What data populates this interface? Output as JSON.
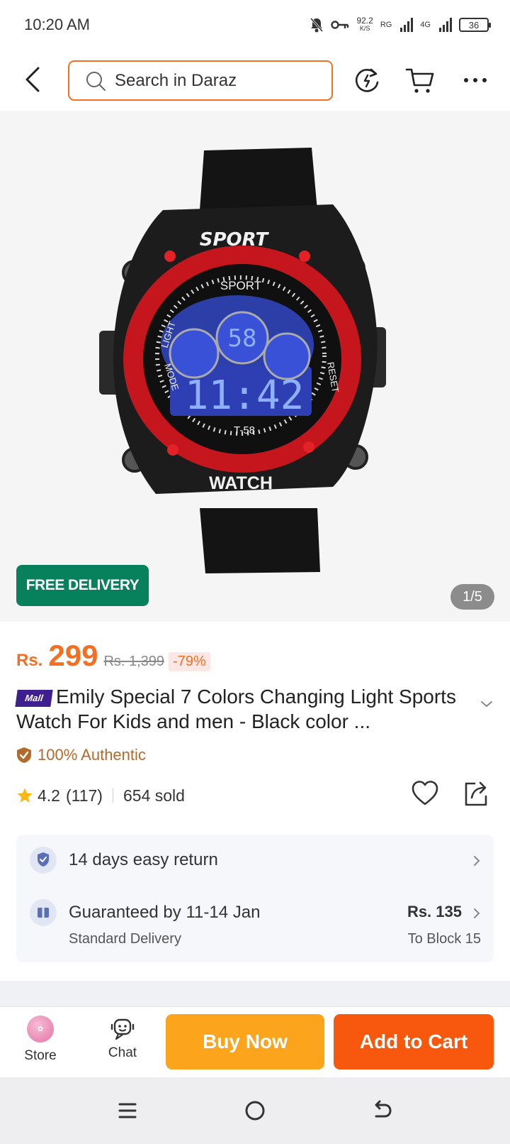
{
  "status_bar": {
    "time": "10:20 AM",
    "net_speed_value": "92.2",
    "net_speed_unit": "K/S",
    "sim1_label": "RG",
    "sim2_label": "4G",
    "battery": "36"
  },
  "header": {
    "search_placeholder": "Search in Daraz"
  },
  "gallery": {
    "badge": "FREE DELIVERY",
    "counter": "1/5",
    "watch_brand_text": "SPORT",
    "watch_face_text": "SPORT",
    "watch_model": "T-58",
    "watch_label": "WATCH",
    "watch_left_text": "LIGHT",
    "watch_mode_text": "MODE",
    "watch_right_text": "RESET"
  },
  "product": {
    "currency": "Rs.",
    "price": "299",
    "original_price": "Rs. 1,399",
    "discount": "-79%",
    "mall_badge": "Mall",
    "title": "Emily Special 7 Colors Changing Light Sports Watch For Kids and men - Black color ...",
    "authentic": "100% Authentic",
    "rating": "4.2",
    "review_count": "(117)",
    "sold": "654 sold"
  },
  "services": {
    "return_policy": "14 days easy return",
    "delivery_guarantee": "Guaranteed by 11-14 Jan",
    "delivery_type": "Standard Delivery",
    "delivery_fee": "Rs. 135",
    "destination": "To Block 15"
  },
  "action_bar": {
    "store_label": "Store",
    "chat_label": "Chat",
    "buy_now": "Buy Now",
    "add_to_cart": "Add to Cart"
  },
  "colors": {
    "accent": "#f36f21",
    "buy_now": "#fca41b",
    "add_to_cart": "#f8580d",
    "free_delivery": "#07805c"
  }
}
